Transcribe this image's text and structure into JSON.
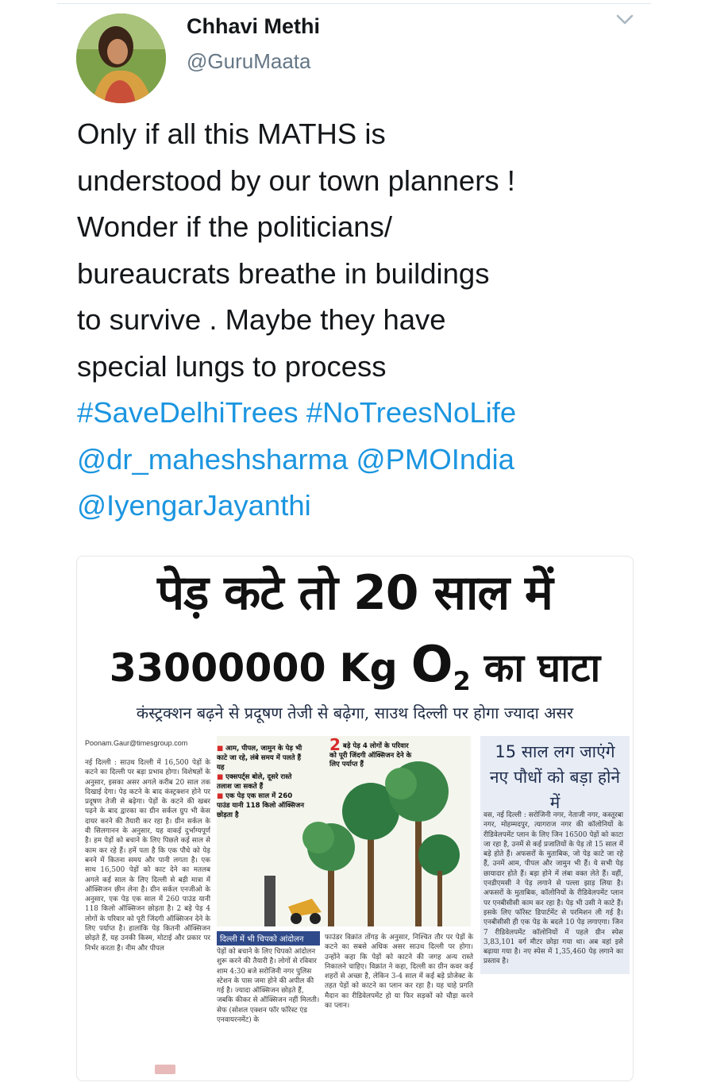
{
  "user": {
    "name": "Chhavi Methi",
    "handle": "@GuruMaata"
  },
  "tweet": {
    "lines": [
      "Only if all this MATHS is",
      "understood by our town planners !",
      "Wonder if the politicians/",
      "bureaucrats breathe in buildings",
      "to survive . Maybe they have",
      "special lungs to process"
    ],
    "hashtag1": "#SaveDelhiTrees",
    "hashtag2": "#NoTreesNoLife",
    "mention1": "@dr_maheshsharma",
    "mention2": "@PMOIndia",
    "mention3": "@IyengarJayanthi"
  },
  "colors": {
    "link": "#1b95e0",
    "text": "#14171a",
    "muted": "#657786"
  },
  "newspaper": {
    "headline1": "पेड़ कटे तो 20 साल में",
    "headline2_num": "33000000 Kg",
    "headline2_o": "O",
    "headline2_sub": "2",
    "headline2_tail": "का घाटा",
    "subheadline": "कंस्ट्रक्शन बढ़ने से प्रदूषण तेजी से बढ़ेगा, साउथ दिल्ली पर होगा ज्यादा असर",
    "byline": "Poonam.Gaur@timesgroup.com",
    "col1": "नई दिल्ली : साउथ दिल्ली में 16,500 पेड़ों के कटने का दिल्ली पर बड़ा प्रभाव होगा। विशेषज्ञों के अनुसार, इसका असर अगले करीब 20 साल तक दिखाई देगा। पेड़ कटने के बाद कंस्ट्रक्शन होने पर प्रदूषण तेजी से बढ़ेगा। पेड़ों के कटने की खबर पढ़ने के बाद द्वारका का ग्रीन सर्कल ग्रुप भी केस दायर करने की तैयारी कर रहा है। ग्रीन सर्कल के वी सिलगानन के अनुसार, यह वाकई दुर्भाग्यपूर्ण है। हम पेड़ों को बचाने के लिए पिछले कई साल से काम कर रहे हैं। हमें पता है कि एक पौधे को पेड़ बनने में कितना समय और पानी लगता है। एक साथ 16,500 पेड़ों को काट देने का मतलब अगले कई साल के लिए दिल्ली से बड़ी मात्रा में ऑक्सिजन छीन लेना है। ग्रीन सर्कल एनजीओ के अनुसार, एक पेड़ एक साल में 260 पाउंड यानी 118 किलो ऑक्सिजन छोड़ता है। 2 बड़े पेड़ 4 लोगों के परिवार को पूरी जिंदगी ऑक्सिजन देने के लिए पर्याप्त है। हालांकि पेड़ कितनी ऑक्सिजन छोड़ते हैं, यह उनकी किस्म, मोटाई और प्रकार पर निर्भर करता है। नीम और पीपल",
    "bullets": [
      "आम, पीपल, जामुन के पेड़ भी काटे जा रहे, लंबे समय में पलते हैं यह",
      "एक्सपर्ट्स बोले, दूसरे रास्ते तलाश जा सकते हैं",
      "एक पेड़ एक साल में 260 पाउंड यानी 118 किलो ऑक्सिजन छोड़ता है"
    ],
    "callout_num": "2",
    "callout_text": "बड़े पेड़ 4 लोगों के परिवार को पूरी जिंदगी ऑक्सिजन देने के लिए पर्याप्त हैं",
    "box_head": "दिल्ली में भी चिपको आंदोलन",
    "box_text": "पेड़ों को बचाने के लिए चिपको आंदोलन शुरू करने की तैयारी है। लोगों से रविवार शाम 4:30 बजे सरोजिनी नगर पुलिस स्टेशन के पास जमा होने की अपील की गई है। ज्यादा ऑक्सिजन छोड़ते हैं, जबकि कीकर से ऑक्सिजन नहीं मिलती। सेफ (सोशल एक्शन फॉर फॉरेस्ट एंड एनवायरनमेंट) के",
    "col3": "फाउंडर विक्रांत तोंगड़ के अनुसार, निश्चित तौर पर पेड़ों के कटने का सबसे अधिक असर साउथ दिल्ली पर होगा। उन्होंने कहा कि पेड़ों को काटने की जगह अन्य रास्ते निकालने चाहिए। विक्रांत ने कहा, दिल्ली का ग्रीन कवर कई शहरों से अच्छा है, लेकिन 3-4 साल में कई बड़े प्रोजेक्ट के तहत पेड़ों को काटने का प्लान कर रहा है। यह चाहे प्रगति मैदान का रीडिवेलपमेंट हो या फिर सड़कों को चौड़ा करने का प्लान।",
    "side_head": "15 साल लग जाएंगे नए पौधों को बड़ा होने में",
    "col4": "वस, नई दिल्ली : सरोजिनी नगर, नेताजी नगर, कस्तूरबा नगर, मोहम्मदपुर, त्यागराज नगर की कॉलोनियों के रीडिवेलपमेंट प्लान के लिए जिन 16500 पेड़ों को काटा जा रहा है, उनमें से कई प्रजातियों के पेड़ तो 15 साल में बड़े होते हैं। अफसरों के मुताबिक, जो पेड़ काटे जा रहे हैं, उनमें आम, पीपल और जामुन भी हैं। ये सभी पेड़ छायादार होते हैं। बड़ा होने में लंबा वक्त लेते हैं। वहीं, एनडीएमसी ने पेड़ लगाने से पल्ला झाड़ लिया है। अफसरों के मुताबिक, कॉलोनियों के रीडिवेलपमेंट प्लान पर एनबीसीसी काम कर रहा है। पेड़ भी उसी ने काटे हैं। इसके लिए फॉरेस्ट डिपार्टमेंट से परमिशन ली गई है। एनबीसीसी ही एक पेड़ के बदले 10 पेड़ लगाएगा। जिन 7 रीडिवेलपमेंट कॉलोनियों में पहले ग्रीन स्पेस 3,83,101 वर्ग मीटर छोड़ा गया था। अब वहां इसे बढ़ाया गया है। नए स्पेस में 1,35,460 पेड़ लगाने का प्रस्ताव है।"
  }
}
